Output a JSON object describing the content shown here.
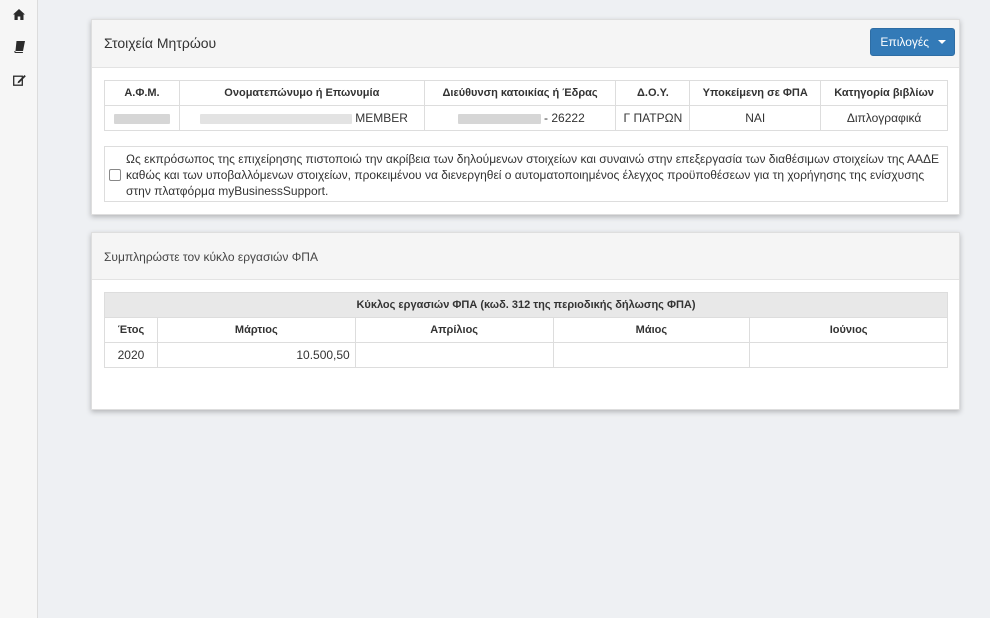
{
  "sidebar": {
    "items": [
      {
        "icon": "home-icon"
      },
      {
        "icon": "book-icon"
      },
      {
        "icon": "edit-icon"
      }
    ]
  },
  "registry_panel": {
    "title": "Στοιχεία Μητρώου",
    "options_button": "Επιλογές",
    "table": {
      "headers": [
        "Α.Φ.Μ.",
        "Ονοματεπώνυμο ή Επωνυμία",
        "Διεύθυνση κατοικίας ή Έδρας",
        "Δ.Ο.Υ.",
        "Υποκείμενη σε ΦΠΑ",
        "Κατηγορία βιβλίων"
      ],
      "row": {
        "afm": "",
        "name_suffix": "MEMBER",
        "address_suffix": "- 26222",
        "doy": "Γ ΠΑΤΡΩΝ",
        "vat_subject": "ΝΑΙ",
        "books_category": "Διπλογραφικά"
      }
    },
    "confirmation_text": "Ως εκπρόσωπος της επιχείρησης πιστοποιώ την ακρίβεια των δηλούμενων στοιχείων και συναινώ στην επεξεργασία των διαθέσιμων στοιχείων της ΑΑΔΕ καθώς και των υποβαλλόμενων στοιχείων, προκειμένου να διενεργηθεί ο αυτοματοποιημένος έλεγχος προϋποθέσεων για τη χορήγησης της ενίσχυσης στην πλατφόρμα myBusinessSupport.",
    "confirmed": false
  },
  "vat_panel": {
    "title": "Συμπληρώστε τον κύκλο εργασιών ΦΠΑ",
    "table_caption": "Κύκλος εργασιών ΦΠΑ (κωδ. 312 της περιοδικής δήλωσης ΦΠΑ)",
    "headers": [
      "Έτος",
      "Μάρτιος",
      "Απρίλιος",
      "Μάιος",
      "Ιούνιος"
    ],
    "row": {
      "year": "2020",
      "march": "10.500,50",
      "april": "",
      "may": "",
      "june": ""
    }
  },
  "colors": {
    "primary_button": "#337ab7",
    "page_background": "#eef0f3",
    "panel_heading": "#f5f5f5"
  }
}
